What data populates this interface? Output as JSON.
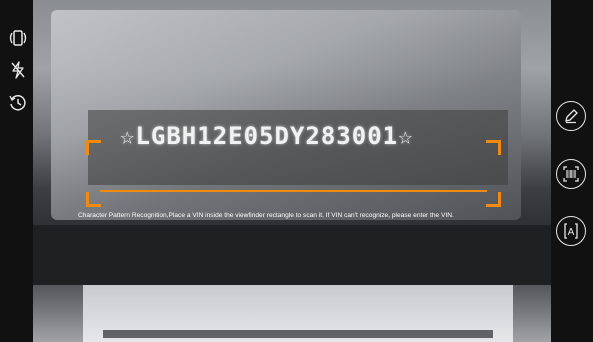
{
  "scan": {
    "vin_text": "☆LGBH12E05DY283001☆",
    "instruction": "Character Pattern Recognition,Place a VIN inside the viewfinder rectangle to scan it. If VIN can't recognize, please enter the VIN."
  },
  "left_toolbar": {
    "icons": [
      "rotate-screen-icon",
      "flash-off-icon",
      "history-icon"
    ]
  },
  "right_toolbar": {
    "icons": [
      "edit-icon",
      "barcode-scan-icon",
      "text-recognition-icon"
    ],
    "text_recognition_glyph": "A"
  },
  "colors": {
    "accent": "#f28a12",
    "icon": "#e8e8e8"
  }
}
